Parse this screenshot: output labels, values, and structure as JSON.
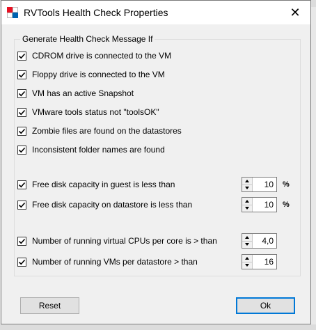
{
  "window": {
    "title": "RVTools Health Check Properties"
  },
  "group": {
    "legend": "Generate Health Check Message If"
  },
  "checks": [
    {
      "label": "CDROM drive is connected to the VM",
      "checked": true
    },
    {
      "label": "Floppy drive is connected to the VM",
      "checked": true
    },
    {
      "label": "VM has an active Snapshot",
      "checked": true
    },
    {
      "label": "VMware tools status not \"toolsOK\"",
      "checked": true
    },
    {
      "label": "Zombie files are found on the datastores",
      "checked": true
    },
    {
      "label": "Inconsistent folder names are found",
      "checked": true
    },
    {
      "label": "Free disk capacity in guest is less than",
      "checked": true
    },
    {
      "label": "Free disk capacity on datastore is less than",
      "checked": true
    },
    {
      "label": "Number of running virtual CPUs per core is > than",
      "checked": true
    },
    {
      "label": "Number of running VMs per datastore > than",
      "checked": true
    }
  ],
  "spinners": [
    {
      "value": "10",
      "unit": "%"
    },
    {
      "value": "10",
      "unit": "%"
    },
    {
      "value": "4,0"
    },
    {
      "value": "16"
    }
  ],
  "buttons": {
    "reset": "Reset",
    "ok": "Ok"
  },
  "icons": {
    "app": "rvtools-app-icon",
    "close": "close-icon",
    "check": "checkmark-icon"
  },
  "colors": {
    "accent": "#0078d7",
    "icon_red": "#e81123",
    "icon_blue": "#0063b1"
  }
}
